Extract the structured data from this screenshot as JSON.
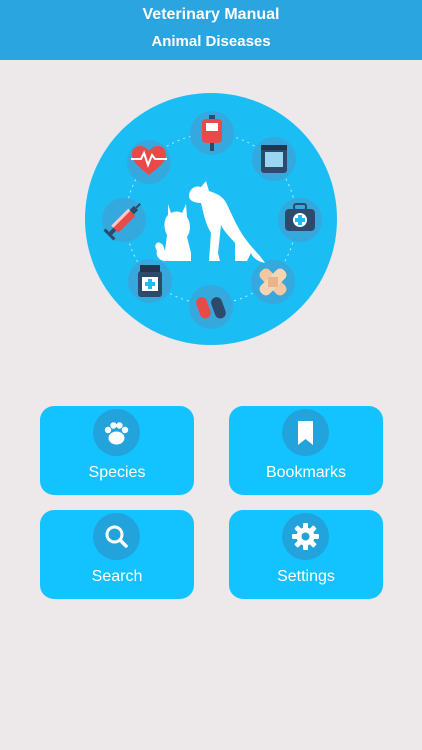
{
  "header": {
    "title": "Veterinary Manual",
    "subtitle": "Animal Diseases"
  },
  "hero": {
    "icons": [
      "heartbeat-icon",
      "iv-bag-icon",
      "medicine-box-icon",
      "first-aid-kit-icon",
      "bandage-icon",
      "pills-icon",
      "medicine-bottle-icon",
      "syringe-icon"
    ],
    "center": "dog-and-cat-icon"
  },
  "menu": {
    "species": {
      "label": "Species",
      "icon": "paw-icon"
    },
    "bookmarks": {
      "label": "Bookmarks",
      "icon": "bookmark-icon"
    },
    "search": {
      "label": "Search",
      "icon": "search-icon"
    },
    "settings": {
      "label": "Settings",
      "icon": "gear-icon"
    }
  },
  "colors": {
    "header": "#2aa5e0",
    "tile": "#13c3ff",
    "tile_icon_bg": "#22a3dc",
    "hero": "#1bbdf5",
    "background": "#ede8ea"
  }
}
